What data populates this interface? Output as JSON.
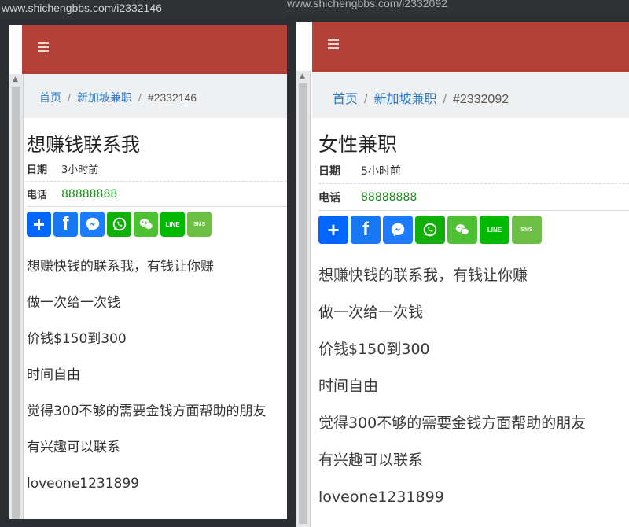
{
  "left": {
    "url": "www.shichengbbs.com/i2332146",
    "breadcrumb": {
      "home": "首页",
      "category": "新加坡兼职",
      "id": "#2332146"
    },
    "title": "想赚钱联系我",
    "date_label": "日期",
    "date_value": "3小时前",
    "phone_label": "电话",
    "phone_value": "88888888",
    "description": [
      "想赚快钱的联系我，有钱让你赚",
      "做一次给一次钱",
      "价钱$150到300",
      "时间自由",
      "觉得300不够的需要金钱方面帮助的朋友",
      "有兴趣可以联系",
      "loveone1231899"
    ]
  },
  "right": {
    "url": "www.shichengbbs.com/i2332092",
    "breadcrumb": {
      "home": "首页",
      "category": "新加坡兼职",
      "id": "#2332092"
    },
    "title": "女性兼职",
    "date_label": "日期",
    "date_value": "5小时前",
    "phone_label": "电话",
    "phone_value": "88888888",
    "description": [
      "想赚快钱的联系我，有钱让你赚",
      "做一次给一次钱",
      "价钱$150到300",
      "时间自由",
      "觉得300不够的需要金钱方面帮助的朋友",
      "有兴趣可以联系",
      "loveone1231899"
    ]
  },
  "share": {
    "add": "+",
    "facebook": "f",
    "line": "LINE",
    "sms": "SMS"
  },
  "icons": [
    "menu-icon",
    "add-share-icon",
    "facebook-icon",
    "messenger-icon",
    "whatsapp-icon",
    "wechat-icon",
    "line-icon",
    "sms-icon"
  ],
  "colors": {
    "navbar": "#b34137",
    "link": "#2a78c7",
    "phone": "#1a8f1a"
  }
}
